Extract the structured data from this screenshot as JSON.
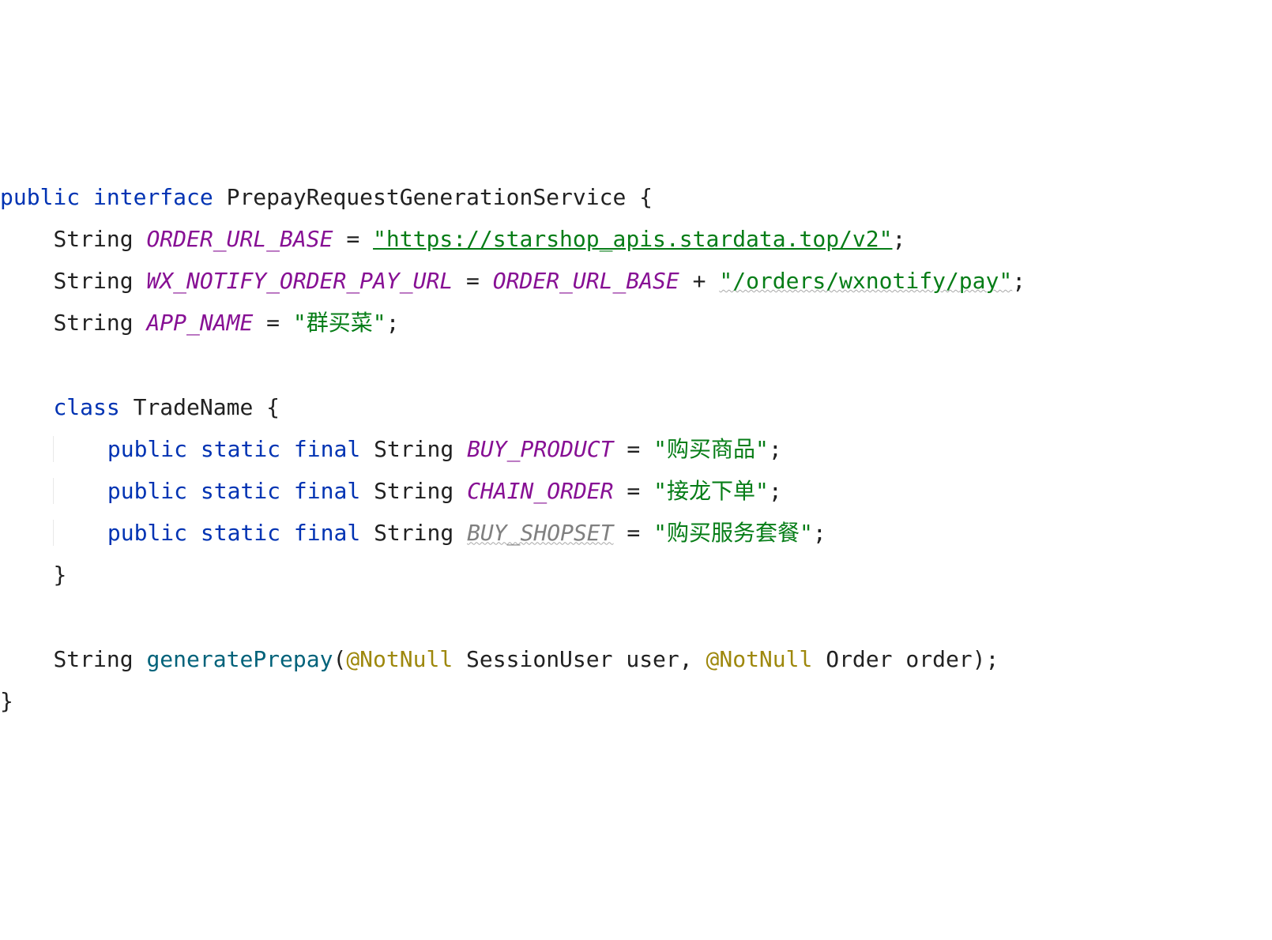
{
  "code": {
    "kw_public": "public",
    "kw_interface": "interface",
    "kw_class": "class",
    "kw_static": "static",
    "kw_final": "final",
    "type_string": "String",
    "interface_name": "PrepayRequestGenerationService",
    "field_order_url_base": "ORDER_URL_BASE",
    "val_order_url_base": "\"https://starshop_apis.stardata.top/v2\"",
    "field_wx_notify": "WX_NOTIFY_ORDER_PAY_URL",
    "val_wx_notify_suffix": "\"/orders/wxnotify/pay\"",
    "field_app_name": "APP_NAME",
    "val_app_name": "\"群买菜\"",
    "class_tradename": "TradeName",
    "field_buy_product": "BUY_PRODUCT",
    "val_buy_product": "\"购买商品\"",
    "field_chain_order": "CHAIN_ORDER",
    "val_chain_order": "\"接龙下单\"",
    "field_buy_shopset": "BUY_SHOPSET",
    "val_buy_shopset": "\"购买服务套餐\"",
    "method_name": "generatePrepay",
    "annot_notnull": "@NotNull",
    "type_sessionuser": "SessionUser",
    "param_user": "user",
    "type_order": "Order",
    "param_order": "order",
    "eq": " = ",
    "plus": " + ",
    "semi": ";",
    "lbrace": " {",
    "rbrace": "}",
    "lparen": "(",
    "rparen": ")",
    "comma": ", ",
    "sp": " "
  }
}
